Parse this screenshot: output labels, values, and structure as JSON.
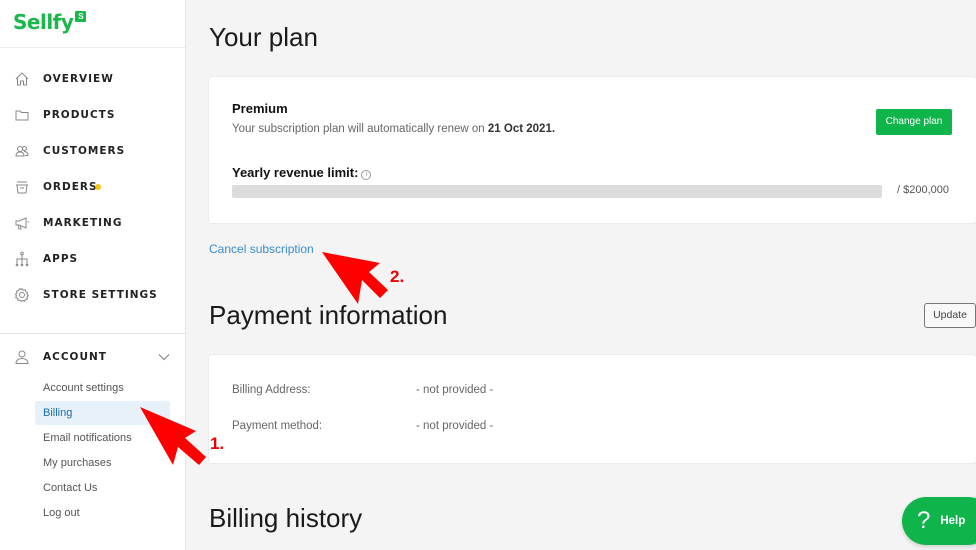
{
  "brand": {
    "name": "Sellfy",
    "badge": "S",
    "color": "#19b84a"
  },
  "sidebar": {
    "items": [
      {
        "label": "OVERVIEW",
        "icon": "home-icon"
      },
      {
        "label": "PRODUCTS",
        "icon": "folder-icon"
      },
      {
        "label": "CUSTOMERS",
        "icon": "customers-icon"
      },
      {
        "label": "ORDERS",
        "icon": "orders-icon",
        "has_notification_dot": true
      },
      {
        "label": "MARKETING",
        "icon": "megaphone-icon"
      },
      {
        "label": "APPS",
        "icon": "apps-icon"
      },
      {
        "label": "STORE SETTINGS",
        "icon": "gear-icon"
      }
    ],
    "account": {
      "label": "ACCOUNT",
      "icon": "user-icon",
      "expanded": true,
      "sub_items": [
        {
          "label": "Account settings",
          "active": false
        },
        {
          "label": "Billing",
          "active": true
        },
        {
          "label": "Email notifications",
          "active": false
        },
        {
          "label": "My purchases",
          "active": false
        },
        {
          "label": "Contact Us",
          "active": false
        },
        {
          "label": "Log out",
          "active": false
        }
      ]
    }
  },
  "main": {
    "plan_section": {
      "title": "Your plan",
      "plan_name": "Premium",
      "renew_text": "Your subscription plan will automatically renew on ",
      "renew_date": "21 Oct 2021.",
      "change_plan_label": "Change plan",
      "limit_label": "Yearly revenue limit:",
      "limit_used_fraction": 0,
      "limit_max": "/ $200,000",
      "cancel_label": "Cancel subscription"
    },
    "payment_section": {
      "title": "Payment information",
      "update_label": "Update",
      "rows": [
        {
          "label": "Billing Address:",
          "value": "- not provided -"
        },
        {
          "label": "Payment method:",
          "value": "- not provided -"
        }
      ]
    },
    "billing_history": {
      "title": "Billing history"
    }
  },
  "help": {
    "icon": "?",
    "label": "Help"
  },
  "annotations": [
    {
      "number": "1.",
      "target": "Billing",
      "color": "#e00000"
    },
    {
      "number": "2.",
      "target": "Cancel subscription",
      "color": "#e00000"
    }
  ]
}
